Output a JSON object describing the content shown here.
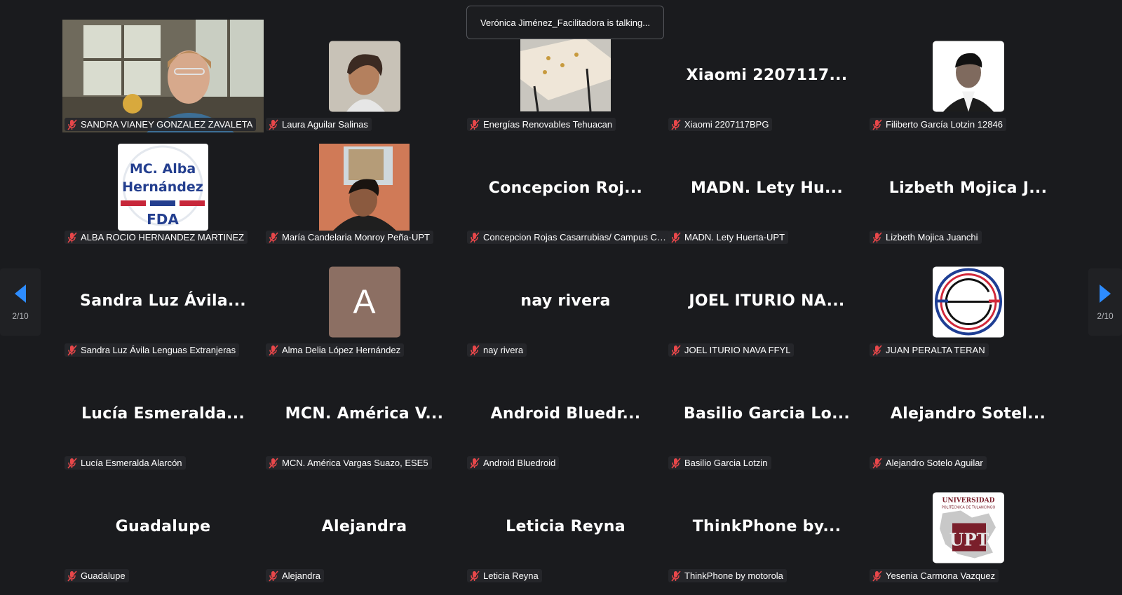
{
  "toast": {
    "text": "Verónica Jiménez_Facilitadora is talking..."
  },
  "pager": {
    "label": "2/10"
  },
  "participants": [
    {
      "big": "",
      "label": "SANDRA VIANEY GONZALEZ ZAVALETA"
    },
    {
      "big": "",
      "label": "Laura Aguilar Salinas"
    },
    {
      "big": "",
      "label": "Energías Renovables Tehuacan"
    },
    {
      "big": "Xiaomi 2207117...",
      "label": "Xiaomi 2207117BPG"
    },
    {
      "big": "",
      "label": "Filiberto García Lotzin 12846"
    },
    {
      "big": "",
      "label": "ALBA ROCIO HERNANDEZ MARTINEZ",
      "logo_lines": [
        "MC. Alba",
        "Hernández",
        "FDA"
      ]
    },
    {
      "big": "",
      "label": "María Candelaria Monroy Peña-UPT"
    },
    {
      "big": "Concepcion Roj...",
      "label": "Concepcion Rojas Casarrubias/ Campus Co..."
    },
    {
      "big": "MADN. Lety Hu...",
      "label": "MADN. Lety Huerta-UPT"
    },
    {
      "big": "Lizbeth Mojica J...",
      "label": "Lizbeth Mojica Juanchi"
    },
    {
      "big": "Sandra Luz Ávila...",
      "label": "Sandra Luz Ávila Lenguas Extranjeras"
    },
    {
      "big": "",
      "label": "Alma Delia López Hernández",
      "initial": "A"
    },
    {
      "big": "nay rivera",
      "label": "nay rivera"
    },
    {
      "big": "JOEL ITURIO NA...",
      "label": "JOEL ITURIO NAVA FFYL"
    },
    {
      "big": "",
      "label": "JUAN PERALTA TERAN"
    },
    {
      "big": "Lucía Esmeralda...",
      "label": "Lucía Esmeralda Alarcón"
    },
    {
      "big": "MCN. América V...",
      "label": "MCN. América Vargas Suazo, ESE5"
    },
    {
      "big": "Android Bluedr...",
      "label": "Android Bluedroid"
    },
    {
      "big": "Basilio Garcia Lo...",
      "label": "Basilio Garcia Lotzin"
    },
    {
      "big": "Alejandro Sotel...",
      "label": "Alejandro Sotelo Aguilar"
    },
    {
      "big": "Guadalupe",
      "label": "Guadalupe"
    },
    {
      "big": "Alejandra",
      "label": "Alejandra"
    },
    {
      "big": "Leticia Reyna",
      "label": "Leticia Reyna"
    },
    {
      "big": "ThinkPhone by...",
      "label": "ThinkPhone by motorola"
    },
    {
      "big": "",
      "label": "Yesenia Carmona Vazquez",
      "logo_lines": [
        "UNIVERSIDAD",
        "POLITÉCNICA DE TULANCINGO",
        "UPT"
      ]
    }
  ],
  "colors": {
    "background": "#1a1b1e",
    "muted_mic": "#e8474a",
    "nav_arrow": "#2d8cff"
  },
  "icons": {
    "mic": "muted-mic-icon",
    "prev": "arrow-left-icon",
    "next": "arrow-right-icon"
  }
}
